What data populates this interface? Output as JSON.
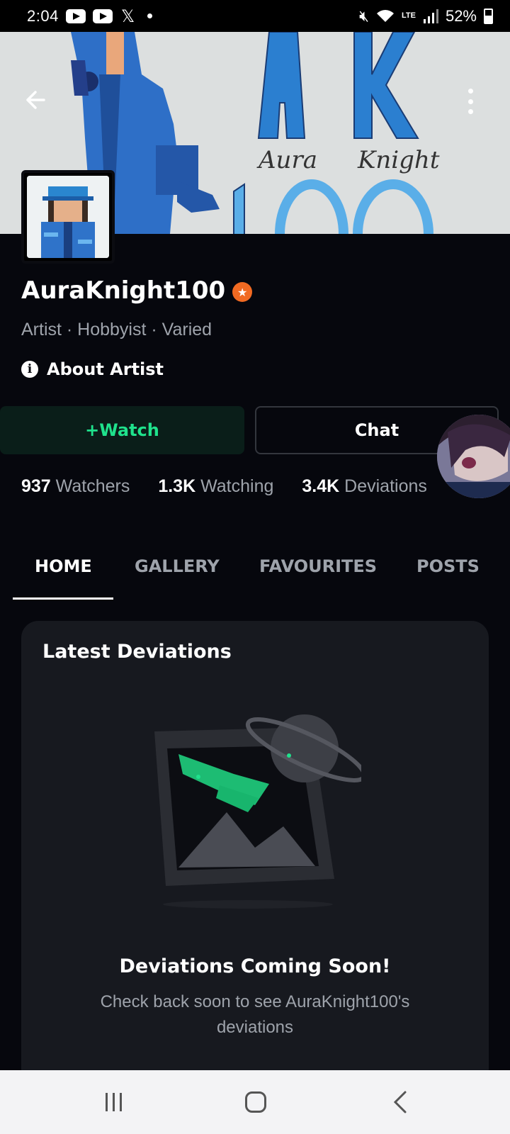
{
  "status_bar": {
    "time": "2:04",
    "battery": "52%",
    "network": "LTE"
  },
  "banner": {
    "text_big": "AK",
    "text_small_left": "Aura",
    "text_small_right": "Knight"
  },
  "profile": {
    "username": "AuraKnight100",
    "subtitle": "Artist · Hobbyist · Varied",
    "about_label": "About Artist"
  },
  "actions": {
    "watch_label": "+Watch",
    "chat_label": "Chat"
  },
  "stats": [
    {
      "value": "937",
      "label": "Watchers"
    },
    {
      "value": "1.3K",
      "label": "Watching"
    },
    {
      "value": "3.4K",
      "label": "Deviations"
    }
  ],
  "tabs": [
    "HOME",
    "GALLERY",
    "FAVOURITES",
    "POSTS"
  ],
  "active_tab": "HOME",
  "latest": {
    "title": "Latest Deviations",
    "empty_title": "Deviations Coming Soon!",
    "empty_sub": "Check back soon to see AuraKnight100's deviations"
  },
  "colors": {
    "accent": "#1fe28c",
    "badge": "#f16a22",
    "background": "#06070d",
    "card": "#17191f"
  },
  "icons": [
    "back-arrow-icon",
    "more-vert-icon",
    "info-icon",
    "core-badge-icon",
    "mute-icon",
    "wifi-icon",
    "signal-icon",
    "battery-icon"
  ]
}
